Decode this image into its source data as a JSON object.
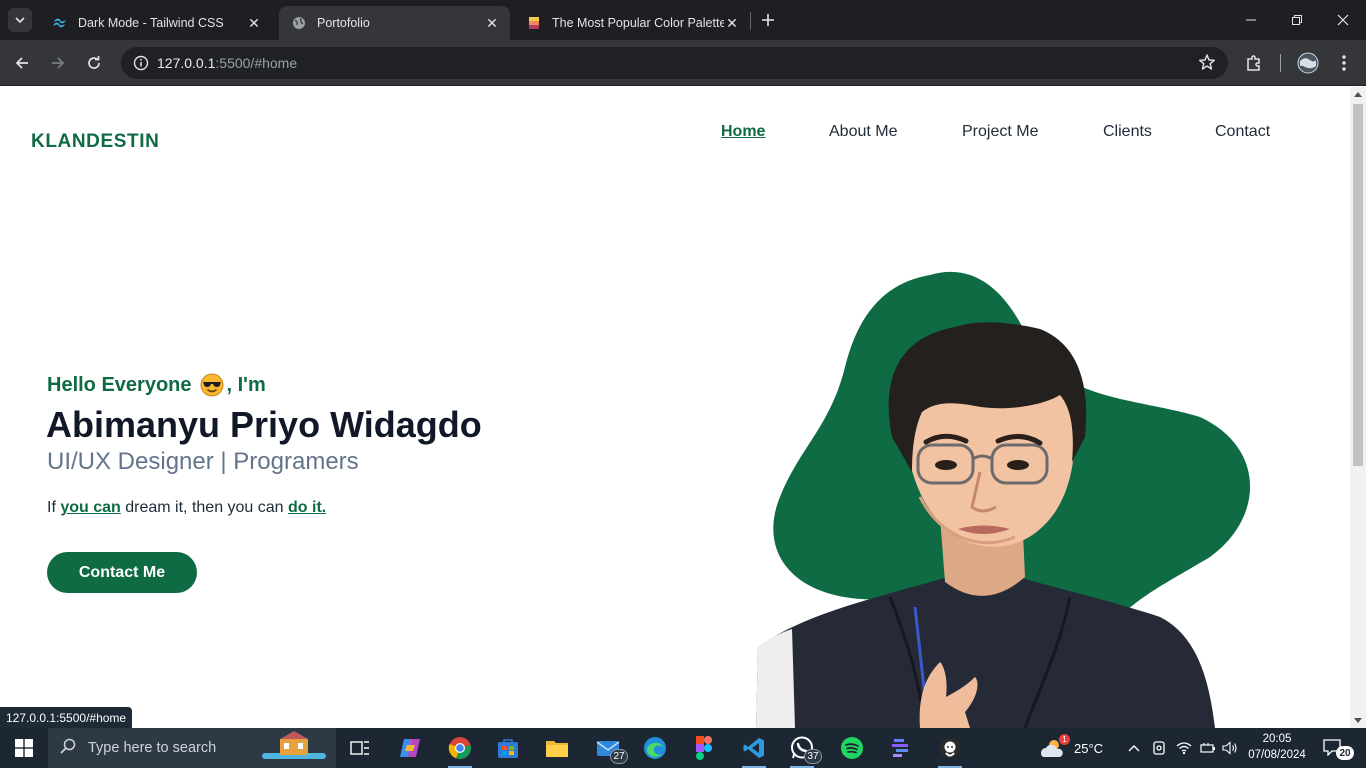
{
  "browser": {
    "tabs": [
      {
        "title": "Dark Mode - Tailwind CSS",
        "active": false
      },
      {
        "title": "Portofolio",
        "active": true
      },
      {
        "title": "The Most Popular Color Palettes",
        "active": false
      }
    ],
    "url_host": "127.0.0.1",
    "url_rest": ":5500/#home",
    "status_url": "127.0.0.1:5500/#home"
  },
  "site": {
    "logo": "KLANDESTIN",
    "nav": [
      {
        "label": "Home",
        "active": true
      },
      {
        "label": "About Me",
        "active": false
      },
      {
        "label": "Project Me",
        "active": false
      },
      {
        "label": "Clients",
        "active": false
      },
      {
        "label": "Contact",
        "active": false
      }
    ],
    "hero": {
      "greeting_before": "Hello Everyone",
      "greeting_after": ", I'm",
      "name": "Abimanyu Priyo Widagdo",
      "role": "UI/UX Designer | Programers",
      "quote_1": "If ",
      "quote_hl_1": "you can",
      "quote_2": " dream it, then you can ",
      "quote_hl_2": "do it.",
      "cta": "Contact Me"
    },
    "accent_color": "#0f6b44"
  },
  "taskbar": {
    "search_placeholder": "Type here to search",
    "mail_badge": "27",
    "whatsapp_badge": "37",
    "weather_temp": "25°C",
    "weather_badge": "1",
    "time": "20:05",
    "date": "07/08/2024",
    "notifications": "20"
  }
}
